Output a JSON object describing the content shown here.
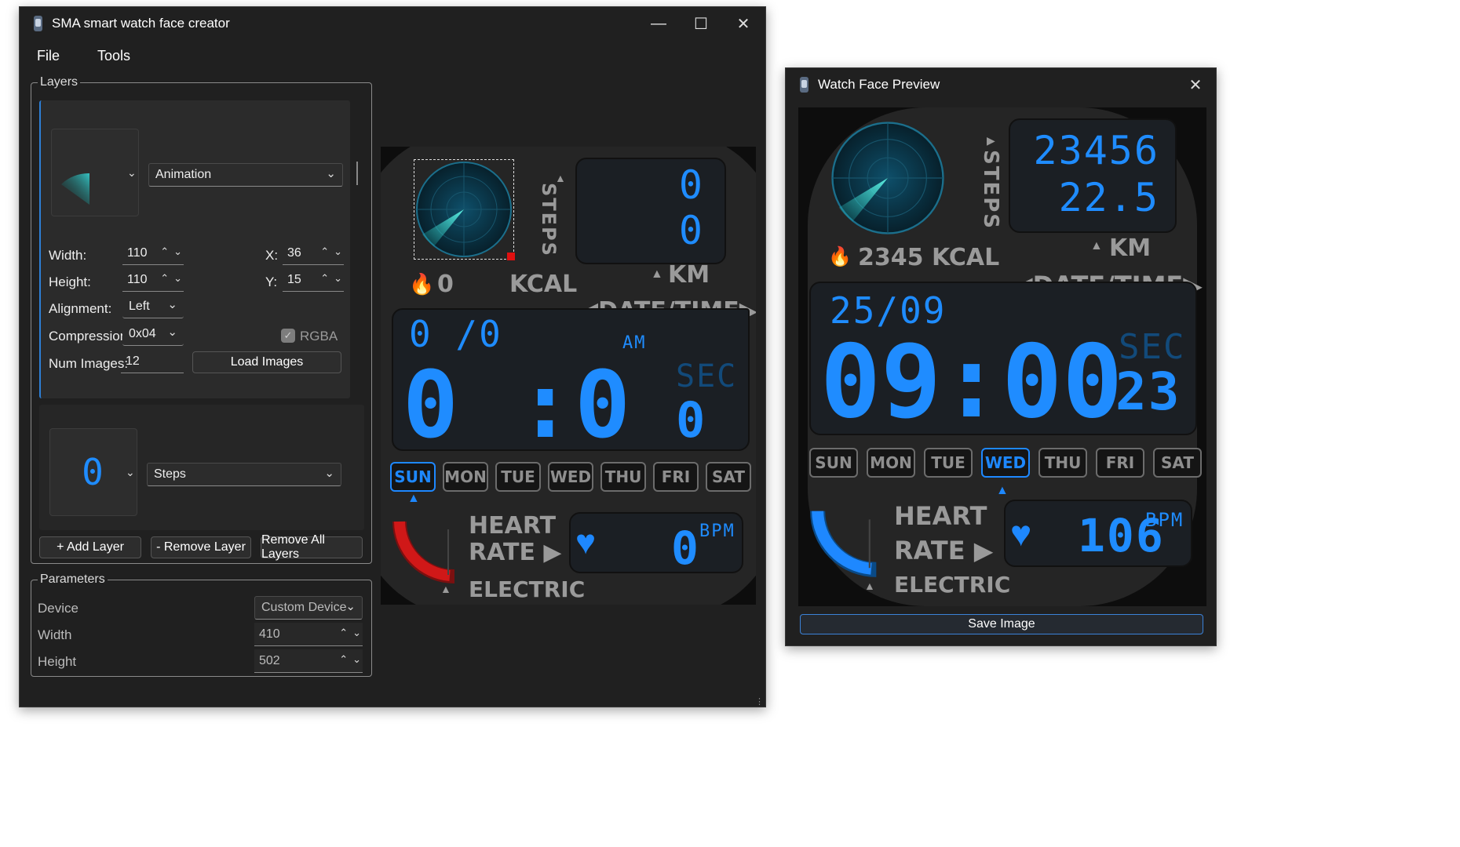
{
  "main": {
    "title": "SMA smart watch face creator",
    "menu": [
      "File",
      "Tools"
    ],
    "layers_legend": "Layers",
    "layer1": {
      "type": "Animation",
      "width_label": "Width:",
      "width": "110",
      "height_label": "Height:",
      "height": "110",
      "x_label": "X:",
      "x": "36",
      "y_label": "Y:",
      "y": "15",
      "alignment_label": "Alignment:",
      "alignment": "Left",
      "compression_label": "Compression:",
      "compression": "0x04",
      "rgba_label": "RGBA",
      "num_images_label": "Num Images:",
      "num_images": "12",
      "load_images": "Load Images"
    },
    "layer2": {
      "type": "Steps",
      "thumb_digit": "0"
    },
    "add_layer": "+ Add Layer",
    "remove_layer": "- Remove Layer",
    "remove_all": "Remove All Layers",
    "params_legend": "Parameters",
    "device_label": "Device",
    "device": "Custom Device",
    "pwidth_label": "Width",
    "pwidth": "410",
    "pheight_label": "Height",
    "pheight": "502"
  },
  "face_left": {
    "steps_label": "STEPS",
    "steps": "0",
    "km": "0",
    "kcal_value": "0",
    "kcal_label": "KCAL",
    "km_label": "KM",
    "datetime_label": "DATE/TIME",
    "date": "0 /0",
    "ampm": "AM",
    "time": "0 :0",
    "sec_label": "SEC",
    "sec": "0",
    "days": [
      "SUN",
      "MON",
      "TUE",
      "WED",
      "THU",
      "FRI",
      "SAT"
    ],
    "active_day": 0,
    "heart_label": "HEART",
    "rate_label": "RATE",
    "bpm_value": "0",
    "bpm_label": "BPM",
    "electric_label": "ELECTRIC",
    "battery_level": 0.8
  },
  "preview": {
    "title": "Watch Face Preview",
    "steps_label": "STEPS",
    "steps": "23456",
    "km": "22.5",
    "kcal": "2345 KCAL",
    "km_label": "KM",
    "datetime_label": "DATE/TIME",
    "date": "25/09",
    "time": "09:00",
    "sec_label": "SEC",
    "sec": "23",
    "days": [
      "SUN",
      "MON",
      "TUE",
      "WED",
      "THU",
      "FRI",
      "SAT"
    ],
    "active_day": 3,
    "heart_label": "HEART",
    "rate_label": "RATE",
    "bpm_value": "106",
    "bpm_label": "BPM",
    "electric_label": "ELECTRIC",
    "battery_level": 0.8,
    "save": "Save Image"
  },
  "colors": {
    "accent": "#1e88ff",
    "red": "#d01818",
    "bg": "#202020"
  },
  "icons": [
    "watch-app-icon",
    "minimize-icon",
    "maximize-icon",
    "close-icon",
    "chevron-down-icon",
    "flame-icon",
    "heart-icon",
    "radar-icon"
  ]
}
